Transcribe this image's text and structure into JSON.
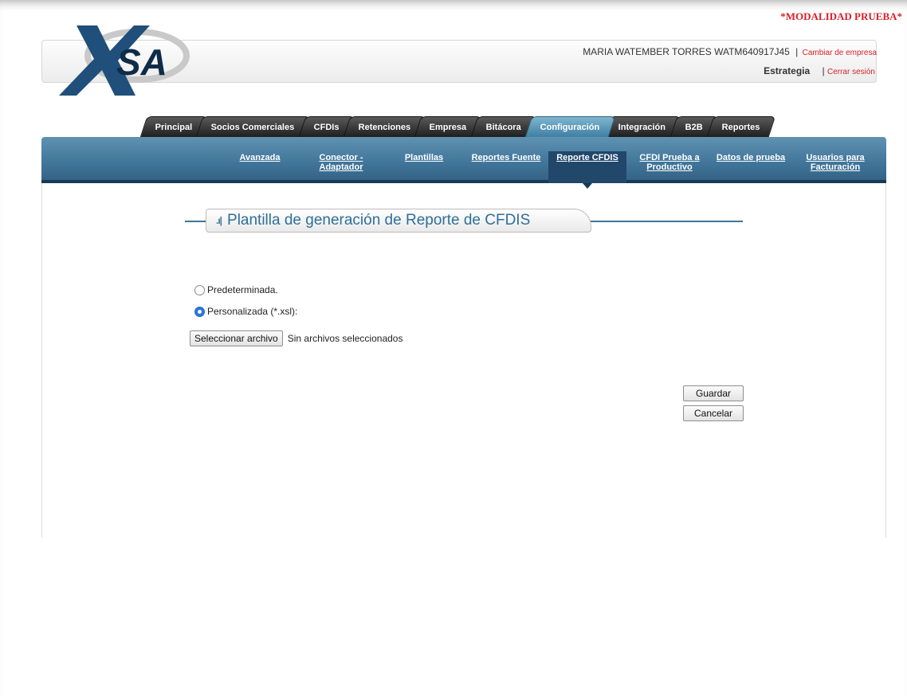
{
  "banner": {
    "mode": "*MODALIDAD PRUEBA*"
  },
  "header": {
    "user": "MARIA WATEMBER TORRES WATM640917J45",
    "separator": "|",
    "change_company": "Cambiar de empresa",
    "company": "Estrategia",
    "logout": "Cerrar sesión"
  },
  "logo": {
    "text": "SA",
    "mark": "X"
  },
  "tabs": [
    {
      "label": "Principal"
    },
    {
      "label": "Socios Comerciales"
    },
    {
      "label": "CFDIs"
    },
    {
      "label": "Retenciones"
    },
    {
      "label": "Empresa"
    },
    {
      "label": "Bitácora"
    },
    {
      "label": "Configuración"
    },
    {
      "label": "Integración"
    },
    {
      "label": "B2B"
    },
    {
      "label": "Reportes"
    }
  ],
  "subnav": [
    {
      "line1": "Avanzada",
      "line2": ""
    },
    {
      "line1": "Conector -",
      "line2": "Adaptador"
    },
    {
      "line1": "Plantillas",
      "line2": ""
    },
    {
      "line1": "Reportes Fuente",
      "line2": ""
    },
    {
      "line1": "Reporte CFDIS",
      "line2": ""
    },
    {
      "line1": "CFDI Prueba a",
      "line2": "Productivo"
    },
    {
      "line1": "Datos de prueba",
      "line2": ""
    },
    {
      "line1": "Usuarios para",
      "line2": "Facturación"
    }
  ],
  "page": {
    "title_icon": ".ı|",
    "title": "Plantilla de generación de Reporte de CFDIS"
  },
  "form": {
    "option_default": "Predeterminada.",
    "option_custom": "Personalizada (*.xsl):",
    "file_button": "Seleccionar archivo",
    "file_status": "Sin archivos seleccionados",
    "save": "Guardar",
    "cancel": "Cancelar"
  }
}
